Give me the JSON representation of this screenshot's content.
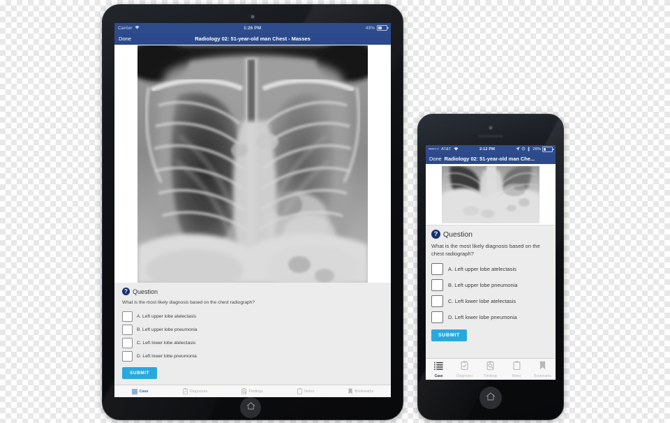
{
  "tablet": {
    "status_bar": {
      "carrier": "Carrier",
      "wifi_icon": "wifi-icon",
      "time": "1:26 PM",
      "battery_percent": "43%",
      "battery_icon": "battery-icon"
    },
    "nav_bar": {
      "back_label": "Done",
      "title": "Radiology 02: 51-year-old man Chest - Masses"
    },
    "image": {
      "name": "chest-radiograph",
      "alt": "Chest X-ray PA view"
    },
    "question": {
      "badge_icon": "question-mark-icon",
      "heading": "Question",
      "prompt": "What is the most likely diagnosis based on the chest radiograph?",
      "options": [
        {
          "label": "A. Left upper lobe atelectasis",
          "checked": false
        },
        {
          "label": "B. Left upper lobe pneumonia",
          "checked": false
        },
        {
          "label": "C. Left lower lobe atelectasis",
          "checked": false
        },
        {
          "label": "D. Left lower lobe pneumonia",
          "checked": false
        }
      ],
      "submit_label": "SUBMIT"
    },
    "tab_bar": [
      {
        "label": "Case",
        "icon": "list-icon",
        "active": true
      },
      {
        "label": "Diagnoses",
        "icon": "clipboard-check-icon",
        "active": false
      },
      {
        "label": "Findings",
        "icon": "clipboard-search-icon",
        "active": false
      },
      {
        "label": "Notes",
        "icon": "clipboard-icon",
        "active": false
      },
      {
        "label": "Bookmarks",
        "icon": "bookmark-icon",
        "active": false
      }
    ],
    "home_button_icon": "home-icon"
  },
  "phone": {
    "status_bar": {
      "signal": "••••○○",
      "carrier": "AT&T",
      "wifi_icon": "wifi-icon",
      "time": "2:12 PM",
      "location_icon": "location-arrow-icon",
      "rotation_lock_icon": "rotation-lock-icon",
      "bluetooth_icon": "bluetooth-icon",
      "battery_percent": "28%",
      "battery_icon": "battery-icon"
    },
    "nav_bar": {
      "back_label": "Done",
      "title": "Radiology 02: 51-year-old man Che..."
    },
    "image": {
      "name": "chest-radiograph",
      "alt": "Chest X-ray lower zone detail"
    },
    "question": {
      "badge_icon": "question-mark-icon",
      "heading": "Question",
      "prompt": "What is the most likely diagnosis based on the chest radiograph?",
      "options": [
        {
          "label": "A. Left upper lobe atelectasis",
          "checked": false
        },
        {
          "label": "B. Left upper lobe pneumonia",
          "checked": false
        },
        {
          "label": "C. Left lower lobe atelectasis",
          "checked": false
        },
        {
          "label": "D. Left lower lobe pneumonia",
          "checked": false
        }
      ],
      "submit_label": "SUBMIT"
    },
    "tab_bar": [
      {
        "label": "Case",
        "icon": "list-icon",
        "active": true
      },
      {
        "label": "Diagnoses",
        "icon": "clipboard-check-icon",
        "active": false
      },
      {
        "label": "Findings",
        "icon": "clipboard-search-icon",
        "active": false
      },
      {
        "label": "Notes",
        "icon": "clipboard-icon",
        "active": false
      },
      {
        "label": "Bookmarks",
        "icon": "bookmark-icon",
        "active": false
      }
    ],
    "home_button_icon": "home-icon"
  },
  "colors": {
    "nav_blue": "#2c4a8b",
    "status_blue": "#2e4c8c",
    "submit_cyan": "#29a8dd",
    "badge_navy": "#15306b",
    "tab_active_blue": "#2d6fb5",
    "screen_gray": "#ececec"
  }
}
